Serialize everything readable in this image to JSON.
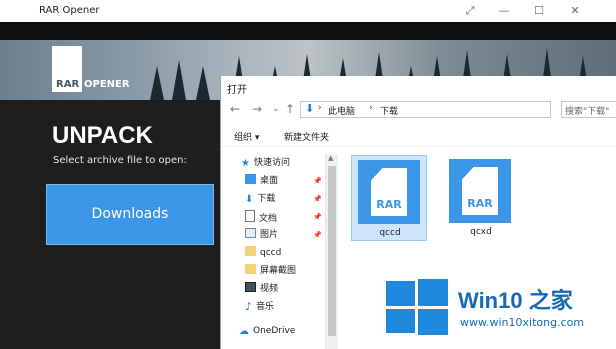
{
  "app": {
    "title": "RAR Opener",
    "logo_rar": "RAR",
    "logo_opener": "OPENER",
    "heading": "UNPACK",
    "subtitle": "Select archive file to open:",
    "downloads_label": "Downloads",
    "window_buttons": {
      "expand": "⤢",
      "minimize": "—",
      "maximize": "☐",
      "close": "✕"
    }
  },
  "dialog": {
    "title": "打开",
    "nav": {
      "back": "←",
      "forward": "→",
      "recent": "⌄",
      "up": "↑",
      "refresh": "↻"
    },
    "path": [
      "此电脑",
      "下载"
    ],
    "search_placeholder": "搜索\"下载\"",
    "toolbar": {
      "organize": "组织 ▾",
      "new_folder": "新建文件夹"
    },
    "nav_items": [
      {
        "label": "快速访问",
        "icon": "star-icon"
      },
      {
        "label": "桌面",
        "icon": "desktop-folder-icon",
        "pinned": true
      },
      {
        "label": "下载",
        "icon": "download-icon",
        "pinned": true
      },
      {
        "label": "文档",
        "icon": "document-icon",
        "pinned": true
      },
      {
        "label": "图片",
        "icon": "picture-icon",
        "pinned": true
      },
      {
        "label": "qccd",
        "icon": "folder-icon"
      },
      {
        "label": "屏幕截图",
        "icon": "folder-icon"
      },
      {
        "label": "视频",
        "icon": "video-icon"
      },
      {
        "label": "音乐",
        "icon": "music-icon"
      },
      {
        "label": "OneDrive",
        "icon": "cloud-icon"
      }
    ],
    "files": [
      {
        "name": "qccd",
        "icon_label": "RAR",
        "selected": true
      },
      {
        "name": "qcxd",
        "icon_label": "RAR",
        "selected": false
      }
    ]
  },
  "watermark": {
    "title": "Win10 之家",
    "url": "www.win10xitong.com"
  },
  "colors": {
    "accent": "#3c96e8",
    "watermark": "#1569b8"
  }
}
